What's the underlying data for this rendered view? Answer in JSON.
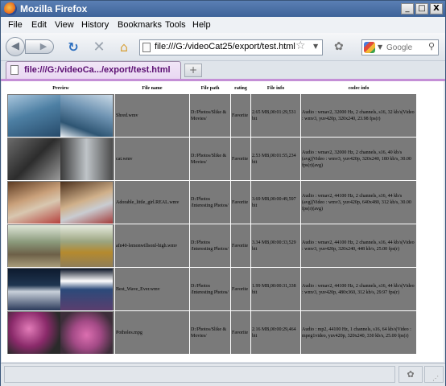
{
  "window": {
    "title": "Mozilla Firefox",
    "minimize": "_",
    "maximize": "□",
    "close": "X"
  },
  "menu": [
    "File",
    "Edit",
    "View",
    "History",
    "Bookmarks",
    "Tools",
    "Help"
  ],
  "nav": {
    "url": "file:///G:/videoCat25/export/test.html",
    "search_placeholder": "Google",
    "back_glyph": "◀",
    "forward_glyph": "▶"
  },
  "tab": {
    "title": "file:///G:/videoCa.../export/test.html",
    "new_tab": "+"
  },
  "table": {
    "headers": [
      "Preview",
      "File name",
      "File path",
      "rating",
      "File info",
      "codec info"
    ],
    "rows": [
      {
        "name": "Shred.wmv",
        "path": "D:/Photos/Slike & Movies/",
        "rating": "Favorite",
        "info": "2.65 MB,00:01:29,531 bit",
        "codec": "Audio : wmav2, 32000 Hz, 2 channels, s16, 32 kb/s|Video : wmv3, yuv420p, 320x240, 23.98 fps(r)"
      },
      {
        "name": "cat.wmv",
        "path": "D:/Photos/Slike & Movies/",
        "rating": "Favorite",
        "info": "2.53 MB,00:01:55,234 bit",
        "codec": "Audio : wmav2, 32000 Hz, 2 channels, s16, 40 kb/s (avg)|Video : wmv3, yuv420p, 320x240, 180 kb/s, 30.00 fps(r)(avg)"
      },
      {
        "name": "Adorable_little_girl.REAL.wmv",
        "path": "D:/Photos /Interesting Photos/",
        "rating": "Favorite",
        "info": "3.69 MB,00:00:49,597 bit",
        "codec": "Audio : wmav2, 44100 Hz, 2 channels, s16, 44 kb/s (avg)|Video : wmv3, yuv420p, 640x480, 312 kb/s, 30.00 fps(r)(avg)"
      },
      {
        "name": "afn40-lemonwillsonl-high.wmv",
        "path": "D:/Photos /Interesting Photos/",
        "rating": "Favorite",
        "info": "3.34 MB,00:00:33,529 bit",
        "codec": "Audio : wmav2, 44100 Hz, 2 channels, s16, 44 kb/s|Video : wmv3, yuv420p, 320x240, 448 kb/s, 25.00 fps(r)"
      },
      {
        "name": "Best_Wave_Ever.wmv",
        "path": "D:/Photos /Interesting Photos/",
        "rating": "Favorite",
        "info": "1.99 MB,00:00:31,338 bit",
        "codec": "Audio : wmav2, 44100 Hz, 2 channels, s16, 44 kb/s|Video : wmv3, yuv420p, 480x360, 312 kb/s, 29.97 fps(r)"
      },
      {
        "name": "Potholes.mpg",
        "path": "D:/Photos/Slike & Movies/",
        "rating": "Favorite",
        "info": "2.16 MB,00:00:29,464 bit",
        "codec": "Audio : mp2, 44100 Hz, 1 channels, s16, 64 kb/s|Video : mpeg1video, yuv420p, 320x240, 330 kb/s, 25.00 fps(r)"
      }
    ]
  }
}
